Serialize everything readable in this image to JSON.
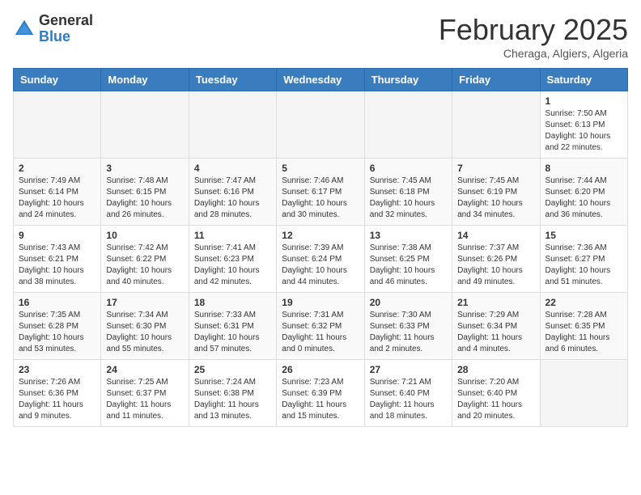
{
  "header": {
    "logo_general": "General",
    "logo_blue": "Blue",
    "month_title": "February 2025",
    "location": "Cheraga, Algiers, Algeria"
  },
  "weekdays": [
    "Sunday",
    "Monday",
    "Tuesday",
    "Wednesday",
    "Thursday",
    "Friday",
    "Saturday"
  ],
  "weeks": [
    [
      {
        "day": "",
        "info": ""
      },
      {
        "day": "",
        "info": ""
      },
      {
        "day": "",
        "info": ""
      },
      {
        "day": "",
        "info": ""
      },
      {
        "day": "",
        "info": ""
      },
      {
        "day": "",
        "info": ""
      },
      {
        "day": "1",
        "info": "Sunrise: 7:50 AM\nSunset: 6:13 PM\nDaylight: 10 hours and 22 minutes."
      }
    ],
    [
      {
        "day": "2",
        "info": "Sunrise: 7:49 AM\nSunset: 6:14 PM\nDaylight: 10 hours and 24 minutes."
      },
      {
        "day": "3",
        "info": "Sunrise: 7:48 AM\nSunset: 6:15 PM\nDaylight: 10 hours and 26 minutes."
      },
      {
        "day": "4",
        "info": "Sunrise: 7:47 AM\nSunset: 6:16 PM\nDaylight: 10 hours and 28 minutes."
      },
      {
        "day": "5",
        "info": "Sunrise: 7:46 AM\nSunset: 6:17 PM\nDaylight: 10 hours and 30 minutes."
      },
      {
        "day": "6",
        "info": "Sunrise: 7:45 AM\nSunset: 6:18 PM\nDaylight: 10 hours and 32 minutes."
      },
      {
        "day": "7",
        "info": "Sunrise: 7:45 AM\nSunset: 6:19 PM\nDaylight: 10 hours and 34 minutes."
      },
      {
        "day": "8",
        "info": "Sunrise: 7:44 AM\nSunset: 6:20 PM\nDaylight: 10 hours and 36 minutes."
      }
    ],
    [
      {
        "day": "9",
        "info": "Sunrise: 7:43 AM\nSunset: 6:21 PM\nDaylight: 10 hours and 38 minutes."
      },
      {
        "day": "10",
        "info": "Sunrise: 7:42 AM\nSunset: 6:22 PM\nDaylight: 10 hours and 40 minutes."
      },
      {
        "day": "11",
        "info": "Sunrise: 7:41 AM\nSunset: 6:23 PM\nDaylight: 10 hours and 42 minutes."
      },
      {
        "day": "12",
        "info": "Sunrise: 7:39 AM\nSunset: 6:24 PM\nDaylight: 10 hours and 44 minutes."
      },
      {
        "day": "13",
        "info": "Sunrise: 7:38 AM\nSunset: 6:25 PM\nDaylight: 10 hours and 46 minutes."
      },
      {
        "day": "14",
        "info": "Sunrise: 7:37 AM\nSunset: 6:26 PM\nDaylight: 10 hours and 49 minutes."
      },
      {
        "day": "15",
        "info": "Sunrise: 7:36 AM\nSunset: 6:27 PM\nDaylight: 10 hours and 51 minutes."
      }
    ],
    [
      {
        "day": "16",
        "info": "Sunrise: 7:35 AM\nSunset: 6:28 PM\nDaylight: 10 hours and 53 minutes."
      },
      {
        "day": "17",
        "info": "Sunrise: 7:34 AM\nSunset: 6:30 PM\nDaylight: 10 hours and 55 minutes."
      },
      {
        "day": "18",
        "info": "Sunrise: 7:33 AM\nSunset: 6:31 PM\nDaylight: 10 hours and 57 minutes."
      },
      {
        "day": "19",
        "info": "Sunrise: 7:31 AM\nSunset: 6:32 PM\nDaylight: 11 hours and 0 minutes."
      },
      {
        "day": "20",
        "info": "Sunrise: 7:30 AM\nSunset: 6:33 PM\nDaylight: 11 hours and 2 minutes."
      },
      {
        "day": "21",
        "info": "Sunrise: 7:29 AM\nSunset: 6:34 PM\nDaylight: 11 hours and 4 minutes."
      },
      {
        "day": "22",
        "info": "Sunrise: 7:28 AM\nSunset: 6:35 PM\nDaylight: 11 hours and 6 minutes."
      }
    ],
    [
      {
        "day": "23",
        "info": "Sunrise: 7:26 AM\nSunset: 6:36 PM\nDaylight: 11 hours and 9 minutes."
      },
      {
        "day": "24",
        "info": "Sunrise: 7:25 AM\nSunset: 6:37 PM\nDaylight: 11 hours and 11 minutes."
      },
      {
        "day": "25",
        "info": "Sunrise: 7:24 AM\nSunset: 6:38 PM\nDaylight: 11 hours and 13 minutes."
      },
      {
        "day": "26",
        "info": "Sunrise: 7:23 AM\nSunset: 6:39 PM\nDaylight: 11 hours and 15 minutes."
      },
      {
        "day": "27",
        "info": "Sunrise: 7:21 AM\nSunset: 6:40 PM\nDaylight: 11 hours and 18 minutes."
      },
      {
        "day": "28",
        "info": "Sunrise: 7:20 AM\nSunset: 6:40 PM\nDaylight: 11 hours and 20 minutes."
      },
      {
        "day": "",
        "info": ""
      }
    ]
  ]
}
